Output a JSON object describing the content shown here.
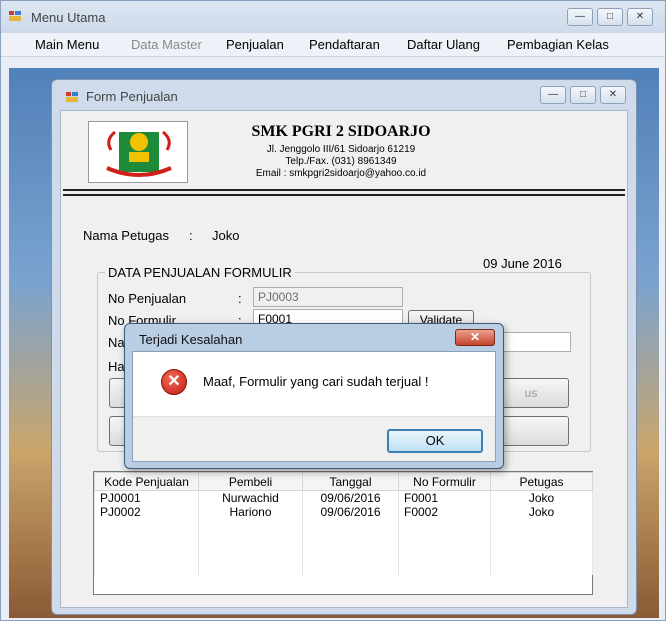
{
  "app": {
    "title": "Menu Utama",
    "menu": [
      {
        "label": "Main Menu",
        "enabled": true
      },
      {
        "label": "Data Master",
        "enabled": false
      },
      {
        "label": "Penjualan",
        "enabled": true
      },
      {
        "label": "Pendaftaran",
        "enabled": true
      },
      {
        "label": "Daftar Ulang",
        "enabled": true
      },
      {
        "label": "Pembagian Kelas",
        "enabled": true
      }
    ]
  },
  "form": {
    "title": "Form Penjualan",
    "header": {
      "school_name": "SMK PGRI 2 SIDOARJO",
      "address": "Jl. Jenggolo III/61 Sidoarjo 61219",
      "phone": "Telp./Fax. (031) 8961349",
      "email": "Email : smkpgri2sidoarjo@yahoo.co.id"
    },
    "petugas_label": "Nama Petugas",
    "separator": ":",
    "petugas_value": "Joko",
    "date": "09 June 2016",
    "group_title": "DATA PENJUALAN FORMULIR",
    "no_penjualan_label": "No Penjualan",
    "no_penjualan_value": "PJ0003",
    "no_formulir_label": "No Formulir",
    "no_formulir_value": "F0001",
    "validate_button": "Validate",
    "partial_label_1": "Na",
    "partial_label_2": "Ha",
    "partial_button_text": "us",
    "table": {
      "headers": [
        "Kode Penjualan",
        "Pembeli",
        "Tanggal",
        "No Formulir",
        "Petugas"
      ],
      "rows": [
        [
          "PJ0001",
          "Nurwachid",
          "09/06/2016",
          "F0001",
          "Joko"
        ],
        [
          "PJ0002",
          "Hariono",
          "09/06/2016",
          "F0002",
          "Joko"
        ]
      ]
    }
  },
  "dialog": {
    "title": "Terjadi Kesalahan",
    "message": "Maaf, Formulir yang cari sudah terjual !",
    "ok_label": "OK",
    "icon": "error-icon"
  }
}
